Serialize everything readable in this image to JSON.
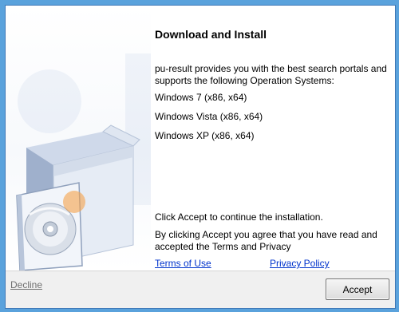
{
  "dialog": {
    "title": "Download and Install",
    "description": "pu-result provides you with the best search portals and supports the following Operation Systems:",
    "os_list": [
      "Windows 7 (x86, x64)",
      "Windows Vista (x86, x64)",
      "Windows XP (x86, x64)"
    ],
    "continue_text": "Click Accept to continue the installation.",
    "agreement_text": "By clicking Accept you agree that you have read and accepted the Terms and Privacy",
    "terms_link": "Terms of Use",
    "privacy_link": "Privacy Policy"
  },
  "footer": {
    "decline_label": "Decline",
    "accept_label": "Accept"
  },
  "icons": {
    "art": "software-box-cd-icon"
  }
}
